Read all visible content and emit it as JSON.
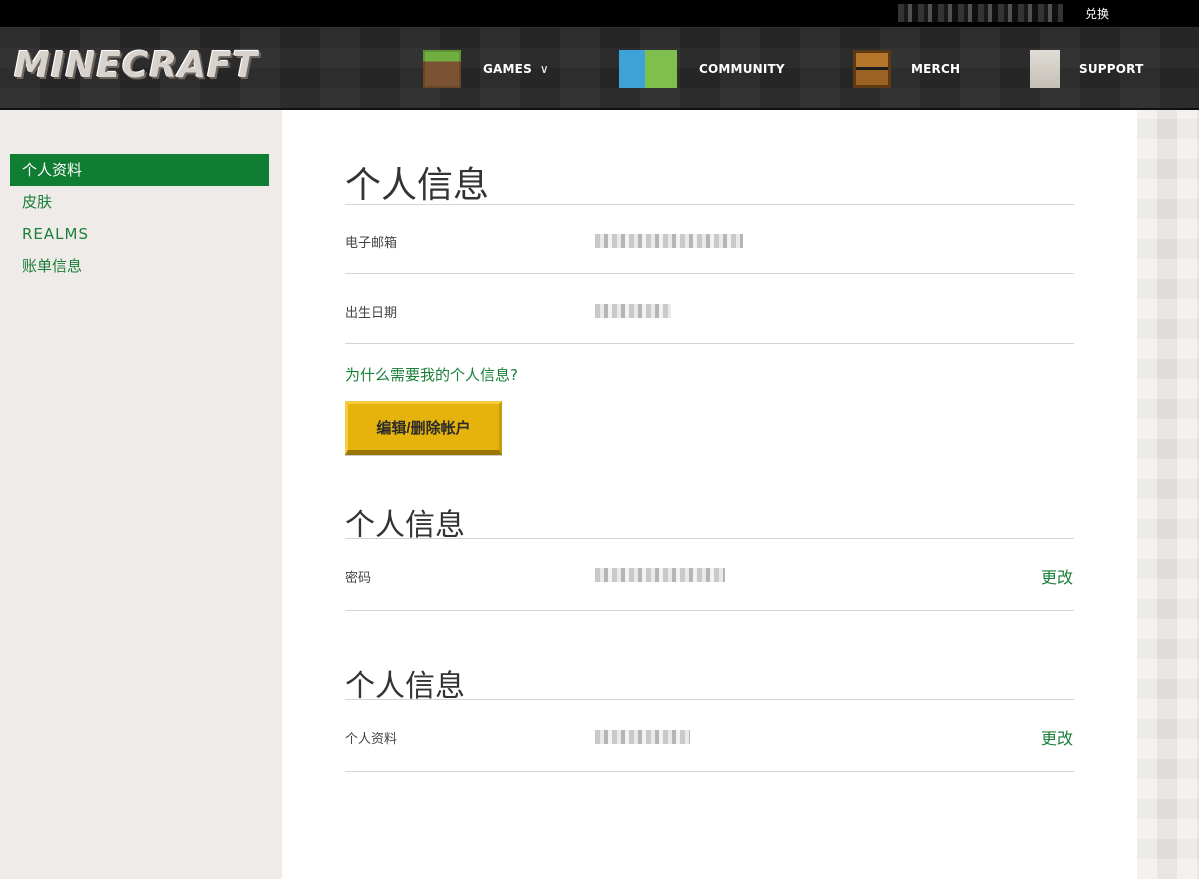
{
  "topbar": {
    "redeem_label": "兑换"
  },
  "nav": {
    "logo": "MINECRAFT",
    "items": [
      {
        "label": "GAMES",
        "icon": "grass-block-icon",
        "has_dropdown": true
      },
      {
        "label": "COMMUNITY",
        "icon": "community-characters-icon"
      },
      {
        "label": "MERCH",
        "icon": "chest-icon"
      },
      {
        "label": "SUPPORT",
        "icon": "iron-golem-icon"
      }
    ],
    "dropdown_glyph": "∨"
  },
  "sidebar": {
    "items": [
      {
        "label": "个人资料",
        "active": true
      },
      {
        "label": "皮肤"
      },
      {
        "label": "REALMS"
      },
      {
        "label": "账单信息"
      }
    ]
  },
  "main": {
    "section1": {
      "title": "个人信息",
      "rows": [
        {
          "label": "电子邮箱"
        },
        {
          "label": "出生日期"
        }
      ],
      "why_link": "为什么需要我的个人信息?",
      "edit_button": "编辑/删除帐户"
    },
    "section2": {
      "title": "个人信息",
      "rows": [
        {
          "label": "密码",
          "action": "更改"
        }
      ]
    },
    "section3": {
      "title": "个人信息",
      "rows": [
        {
          "label": "个人资料",
          "action": "更改"
        }
      ]
    }
  },
  "colors": {
    "accent_green": "#0f7d32",
    "link_green": "#1a7f37",
    "button_yellow": "#e6b30c",
    "nav_bg": "#2a2a2a"
  }
}
